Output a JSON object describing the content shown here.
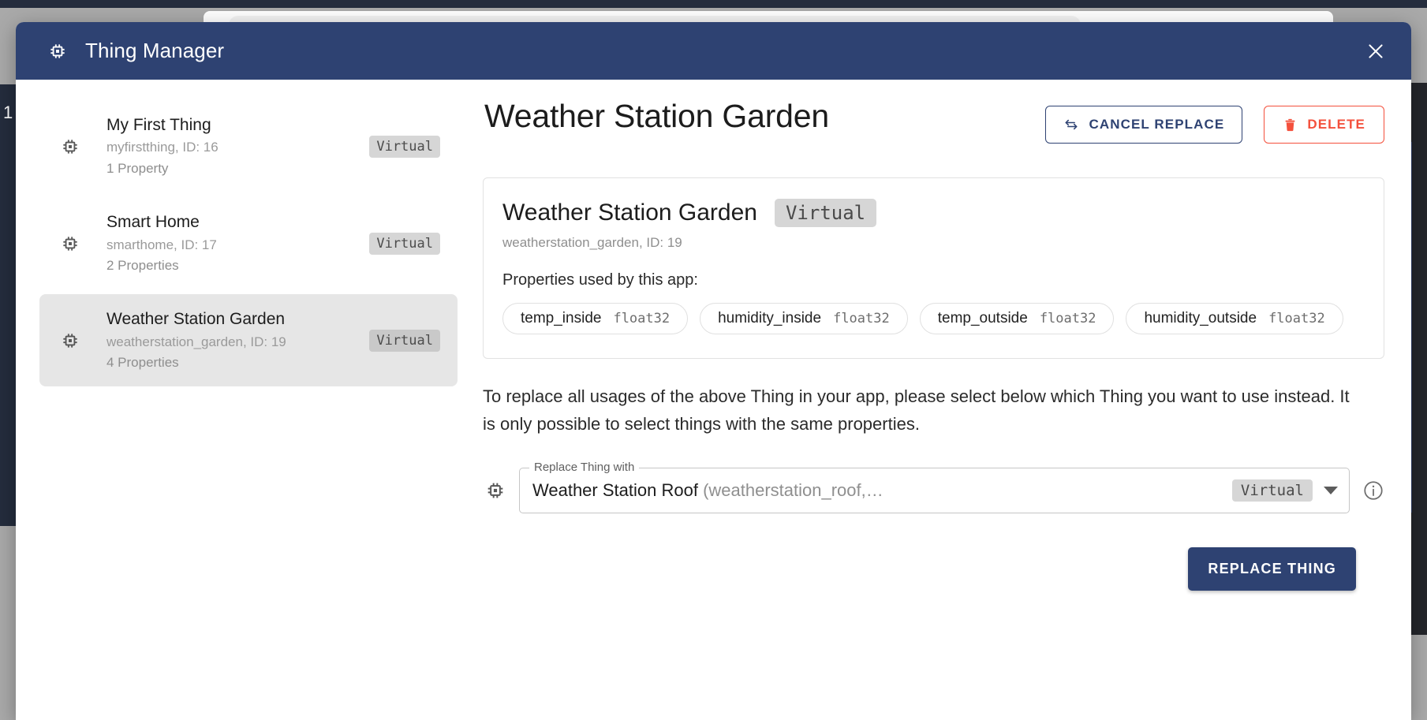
{
  "dialog": {
    "title": "Thing Manager",
    "title_icon": "chip-icon",
    "close_icon": "close-icon",
    "accent_color": "#2e4272"
  },
  "thing_list": [
    {
      "name": "My First Thing",
      "subtitle": "myfirstthing, ID: 16",
      "property_count": "1 Property",
      "badge": "Virtual",
      "selected": false
    },
    {
      "name": "Smart Home",
      "subtitle": "smarthome, ID: 17",
      "property_count": "2 Properties",
      "badge": "Virtual",
      "selected": false
    },
    {
      "name": "Weather Station Garden",
      "subtitle": "weatherstation_garden, ID: 19",
      "property_count": "4 Properties",
      "badge": "Virtual",
      "selected": true
    }
  ],
  "detail": {
    "title": "Weather Station Garden",
    "cancel_replace_label": "CANCEL REPLACE",
    "cancel_replace_icon": "swap-arrows-icon",
    "delete_label": "DELETE",
    "delete_icon": "trash-icon",
    "delete_color": "#f4503c",
    "info_card": {
      "name": "Weather Station Garden",
      "badge": "Virtual",
      "subtitle": "weatherstation_garden, ID: 19",
      "properties_label": "Properties used by this app:",
      "properties": [
        {
          "name": "temp_inside",
          "type": "float32"
        },
        {
          "name": "humidity_inside",
          "type": "float32"
        },
        {
          "name": "temp_outside",
          "type": "float32"
        },
        {
          "name": "humidity_outside",
          "type": "float32"
        }
      ]
    },
    "explanation": "To replace all usages of the above Thing in your app, please select below which Thing you want to use instead. It is only possible to select things with the same properties.",
    "select": {
      "label": "Replace Thing with",
      "value_name": "Weather Station Roof",
      "value_identifier": "(weatherstation_roof,…",
      "badge": "Virtual",
      "caret_icon": "chevron-down-icon",
      "info_icon": "info-circle-icon",
      "leading_icon": "chip-icon"
    },
    "replace_button_label": "REPLACE THING"
  },
  "backdrop": {
    "partial_label": "1"
  }
}
